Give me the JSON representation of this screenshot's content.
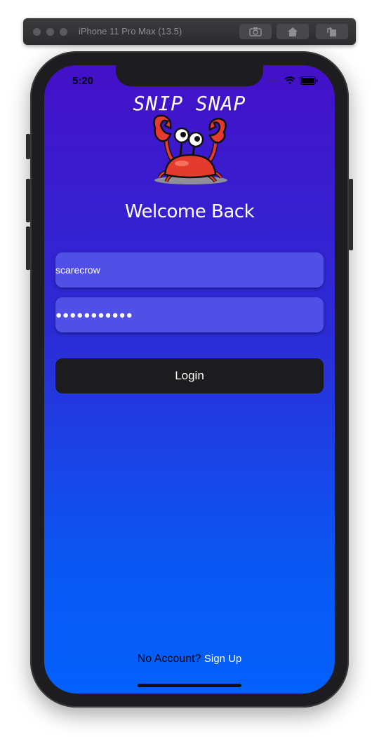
{
  "simulator": {
    "title": "iPhone 11 Pro Max (13.5)",
    "buttons": [
      "screenshot-icon",
      "home-icon",
      "rotate-icon"
    ]
  },
  "status_bar": {
    "time": "5:20",
    "icons": [
      "signal-icon",
      "wifi-icon",
      "battery-icon"
    ]
  },
  "app": {
    "title": "SNIP SNAP",
    "logo": "crab-logo",
    "welcome": "Welcome Back"
  },
  "form": {
    "username_value": "scarecrow",
    "password_masked": "●●●●●●●●●●●",
    "login_label": "Login"
  },
  "footer": {
    "prompt": "No Account?",
    "link": "Sign Up"
  },
  "colors": {
    "gradient_top": "#4410c8",
    "gradient_bottom": "#0460fb",
    "field_bg": "#5050e6",
    "button_bg": "#1c1c1e"
  }
}
